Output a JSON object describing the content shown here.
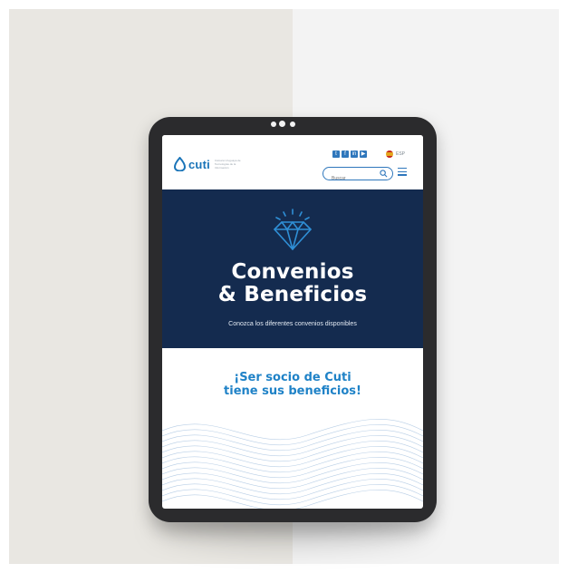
{
  "brand": {
    "name": "cuti",
    "tagline": "Cámara Uruguaya de Tecnologías de la Información",
    "primary_color": "#1a74b8",
    "dark_color": "#142b4f"
  },
  "header": {
    "social_icons": [
      "twitter-icon",
      "facebook-icon",
      "linkedin-icon",
      "youtube-icon"
    ],
    "language": "ESP",
    "search": {
      "placeholder": "Buscar",
      "value": ""
    }
  },
  "hero": {
    "title_line1": "Convenios",
    "title_line2": "& Beneficios",
    "subtitle": "Conozca los diferentes convenios disponibles"
  },
  "promo": {
    "line1": "¡Ser socio de Cuti",
    "line2": "tiene sus beneficios!"
  }
}
